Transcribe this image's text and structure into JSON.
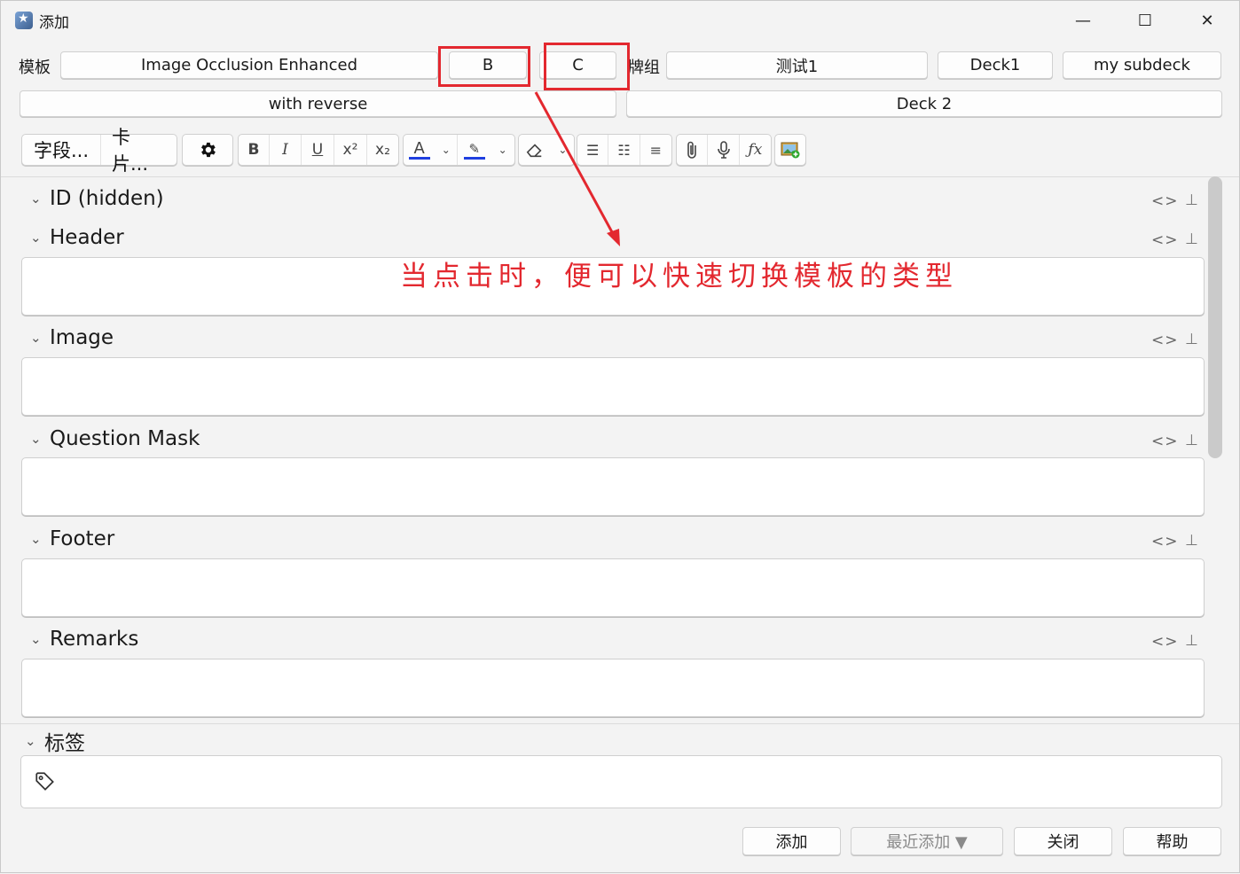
{
  "window": {
    "title": "添加",
    "controls": {
      "minimize": "—",
      "maximize": "☐",
      "close": "✕"
    }
  },
  "model_row": {
    "label": "模板",
    "model_button": "Image Occlusion Enhanced",
    "quick_b": "B",
    "quick_c": "C",
    "deck_label": "牌组",
    "deck_buttons": [
      "测试1",
      "Deck1",
      "my subdeck"
    ],
    "second_row": [
      "with reverse",
      "Deck 2"
    ]
  },
  "toolbar": {
    "fields_btn": "字段...",
    "cards_btn": "卡片...",
    "options_icon": "gear-icon",
    "formatting": [
      "bold-icon",
      "italic-icon",
      "underline-icon",
      "superscript-icon",
      "subscript-icon"
    ],
    "text_color": "#1f3fe0",
    "highlight_color": "#1f3fe0"
  },
  "fields": [
    {
      "name": "ID (hidden)",
      "has_box": false
    },
    {
      "name": "Header",
      "has_box": true
    },
    {
      "name": "Image",
      "has_box": true
    },
    {
      "name": "Question Mask",
      "has_box": true
    },
    {
      "name": "Footer",
      "has_box": true
    },
    {
      "name": "Remarks",
      "has_box": true
    }
  ],
  "field_controls": {
    "html_toggle": "<>",
    "pin": "⊥"
  },
  "tags": {
    "label": "标签"
  },
  "annotation": {
    "text": "当点击时，便可以快速切换模板的类型",
    "color": "#e3282f"
  },
  "footer": {
    "add": "添加",
    "history": "最近添加 ▼",
    "close": "关闭",
    "help": "帮助"
  }
}
